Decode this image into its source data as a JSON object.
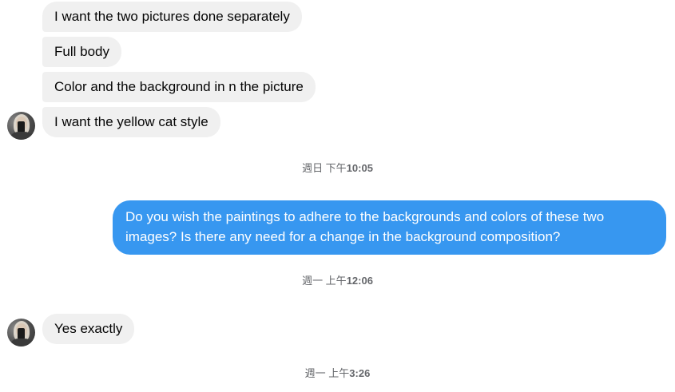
{
  "conversation": {
    "incoming_group_1": [
      "I want the two pictures done separately",
      "Full body",
      "Color and the background in n the picture",
      "I want the yellow cat style"
    ],
    "timestamp_1": {
      "day": "週日 下午",
      "time": "10:05"
    },
    "outgoing_message": "Do you wish the paintings to adhere to the backgrounds and colors of these two images? Is there any need for a change in the background composition?",
    "timestamp_2": {
      "day": "週一 上午",
      "time": "12:06"
    },
    "incoming_group_2": [
      "Yes exactly"
    ],
    "timestamp_3": {
      "day": "週一 上午",
      "time": "3:26"
    }
  },
  "colors": {
    "incoming_bubble": "#f0f0f0",
    "outgoing_bubble": "#3797f0",
    "timestamp_text": "#65676b"
  },
  "icons": {
    "avatar": "contact-avatar"
  }
}
